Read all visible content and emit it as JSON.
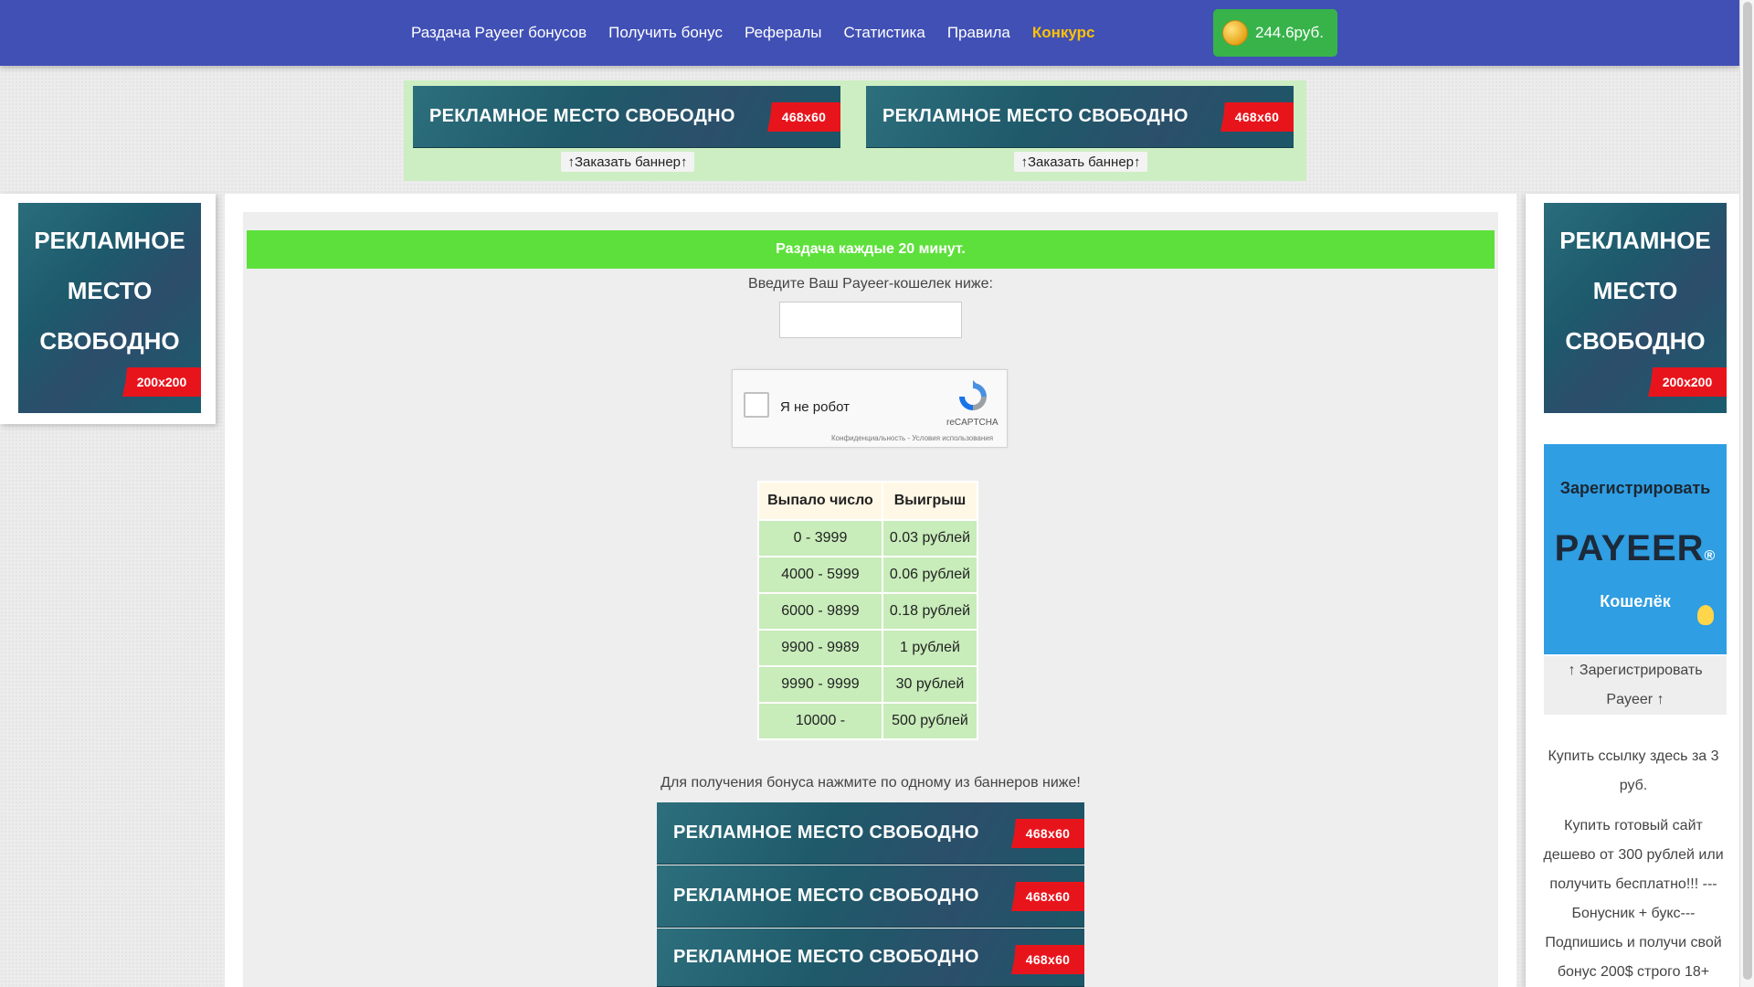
{
  "nav": {
    "links": [
      "Раздача Payeer бонусов",
      "Получить бонус",
      "Рефералы",
      "Статистика",
      "Правила",
      "Конкурс"
    ],
    "balance": "244.6руб."
  },
  "ads": {
    "banner_text": "РЕКЛАМНОЕ  МЕСТО СВОБОДНО",
    "size_468": "468x60",
    "order_banner": "↑Заказать баннер↑",
    "square_lines": [
      "РЕКЛАМНОЕ",
      "МЕСТО",
      "СВОБОДНО"
    ],
    "size_200": "200x200"
  },
  "main": {
    "distribution_notice": "Раздача каждые 20 минут.",
    "wallet_label": "Введите Ваш Payeer-кошелек ниже:",
    "wallet_value": "",
    "captcha": {
      "label": "Я не робот",
      "brand": "reCAPTCHA",
      "links": "Конфиденциальность - Условия использования"
    },
    "table": {
      "headers": [
        "Выпало число",
        "Выигрыш"
      ],
      "rows": [
        [
          "0 - 3999",
          "0.03 рублей"
        ],
        [
          "4000 - 5999",
          "0.06 рублей"
        ],
        [
          "6000 - 9899",
          "0.18 рублей"
        ],
        [
          "9900 - 9989",
          "1 рублей"
        ],
        [
          "9990 - 9999",
          "30 рублей"
        ],
        [
          "10000 -",
          "500 рублей"
        ]
      ]
    },
    "bonus_instruction": "Для получения бонуса нажмите по одному из баннеров ниже!"
  },
  "right": {
    "register_title": "Зарегистрировать",
    "payeer_logo_main": "PAYEER",
    "payeer_logo_mark": "®",
    "payeer_wallet": "Кошелёк",
    "register_link": "↑ Зарегистрировать Payeer ↑",
    "buy_link": "Купить ссылку здесь за 3 руб.",
    "promo_text": "Купить готовый сайт дешево от 300 рублей или получить бесплатно!!! ---Бонусник + букс--- Подпишись и получи свой бонус 200$ строго 18+"
  }
}
